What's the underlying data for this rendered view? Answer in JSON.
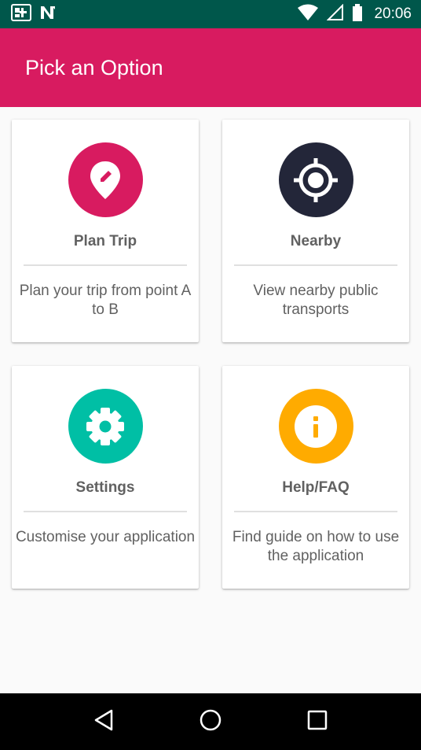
{
  "status_bar": {
    "time": "20:06",
    "icons": [
      "app-notification-icon",
      "n-notification-icon",
      "wifi-icon",
      "signal-icon",
      "battery-icon"
    ]
  },
  "app_bar": {
    "title": "Pick an Option",
    "color": "#d81b60"
  },
  "options": [
    {
      "title": "Plan Trip",
      "description": "Plan your trip from point A to B",
      "icon": "location-pin-edit-icon",
      "color": "#d81b60"
    },
    {
      "title": "Nearby",
      "description": "View nearby public transports",
      "icon": "gps-target-icon",
      "color": "#232639"
    },
    {
      "title": "Settings",
      "description": "Customise your application",
      "icon": "gear-icon",
      "color": "#00bfa5"
    },
    {
      "title": "Help/FAQ",
      "description": "Find guide on how to use the application",
      "icon": "info-icon",
      "color": "#ffab00"
    }
  ],
  "nav_bar": {
    "buttons": [
      "back-icon",
      "home-icon",
      "recents-icon"
    ]
  }
}
